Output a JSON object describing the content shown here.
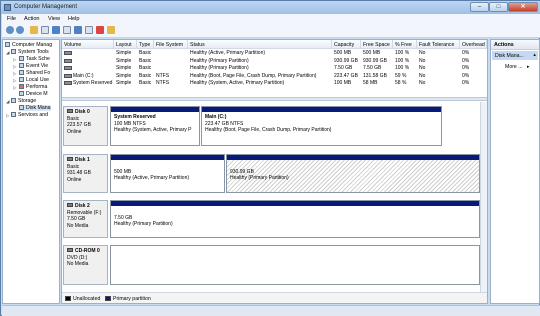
{
  "window": {
    "title": "Computer Management",
    "min": "–",
    "max": "□",
    "close": "✕"
  },
  "menu": [
    "File",
    "Action",
    "View",
    "Help"
  ],
  "tree": {
    "root": "Computer Manag",
    "system_tools": "System Tools",
    "task_scheduler": "Task Sche",
    "event_viewer": "Event Vie",
    "shared_folders": "Shared Fo",
    "local_users": "Local Use",
    "performance": "Performa",
    "device_manager": "Device M",
    "storage": "Storage",
    "disk_management": "Disk Mana",
    "services": "Services and"
  },
  "table": {
    "headers": {
      "volume": "Volume",
      "layout": "Layout",
      "type": "Type",
      "fs": "File System",
      "status": "Status",
      "capacity": "Capacity",
      "free": "Free Space",
      "pct": "% Free",
      "fault": "Fault Tolerance",
      "overhead": "Overhead"
    },
    "rows": [
      {
        "volume": "",
        "layout": "Simple",
        "type": "Basic",
        "fs": "",
        "status": "Healthy (Active, Primary Partition)",
        "capacity": "500 MB",
        "free": "500 MB",
        "pct": "100 %",
        "fault": "No",
        "overhead": "0%"
      },
      {
        "volume": "",
        "layout": "Simple",
        "type": "Basic",
        "fs": "",
        "status": "Healthy (Primary Partition)",
        "capacity": "930.99 GB",
        "free": "930.99 GB",
        "pct": "100 %",
        "fault": "No",
        "overhead": "0%"
      },
      {
        "volume": "",
        "layout": "Simple",
        "type": "Basic",
        "fs": "",
        "status": "Healthy (Primary Partition)",
        "capacity": "7.50 GB",
        "free": "7.50 GB",
        "pct": "100 %",
        "fault": "No",
        "overhead": "0%"
      },
      {
        "volume": "Main (C:)",
        "layout": "Simple",
        "type": "Basic",
        "fs": "NTFS",
        "status": "Healthy (Boot, Page File, Crash Dump, Primary Partition)",
        "capacity": "223.47 GB",
        "free": "131.58 GB",
        "pct": "59 %",
        "fault": "No",
        "overhead": "0%"
      },
      {
        "volume": "System Reserved",
        "layout": "Simple",
        "type": "Basic",
        "fs": "NTFS",
        "status": "Healthy (System, Active, Primary Partition)",
        "capacity": "100 MB",
        "free": "58 MB",
        "pct": "58 %",
        "fault": "No",
        "overhead": "0%"
      }
    ]
  },
  "disks": [
    {
      "name": "Disk 0",
      "type": "Basic",
      "size": "223.57 GB",
      "state": "Online",
      "parts": [
        {
          "title": "System Reserved",
          "size": "100 MB NTFS",
          "status": "Healthy (System, Active, Primary P"
        },
        {
          "title": "Main  (C:)",
          "size": "223.47 GB NTFS",
          "status": "Healthy (Boot, Page File, Crash Dump, Primary Partition)"
        }
      ]
    },
    {
      "name": "Disk 1",
      "type": "Basic",
      "size": "931.48 GB",
      "state": "Online",
      "parts": [
        {
          "title": "",
          "size": "500 MB",
          "status": "Healthy (Active, Primary Partition)"
        },
        {
          "title": "",
          "size": "930.99 GB",
          "status": "Healthy (Primary Partition)"
        }
      ]
    },
    {
      "name": "Disk 2",
      "type": "Removable (F:)",
      "size": "7.50 GB",
      "state": "No Media",
      "parts": [
        {
          "title": "",
          "size": "7.50 GB",
          "status": "Healthy (Primary Partition)"
        }
      ]
    },
    {
      "name": "CD-ROM 0",
      "type": "DVD (D:)",
      "size": "",
      "state": "No Media",
      "parts": []
    }
  ],
  "legend": {
    "unallocated": "Unallocated",
    "primary": "Primary partition"
  },
  "actions": {
    "header": "Actions",
    "disk": "Disk Mana...",
    "more": "More ..."
  },
  "colors": {
    "primary_partition": "#0a1a7a",
    "unallocated": "#000000"
  }
}
